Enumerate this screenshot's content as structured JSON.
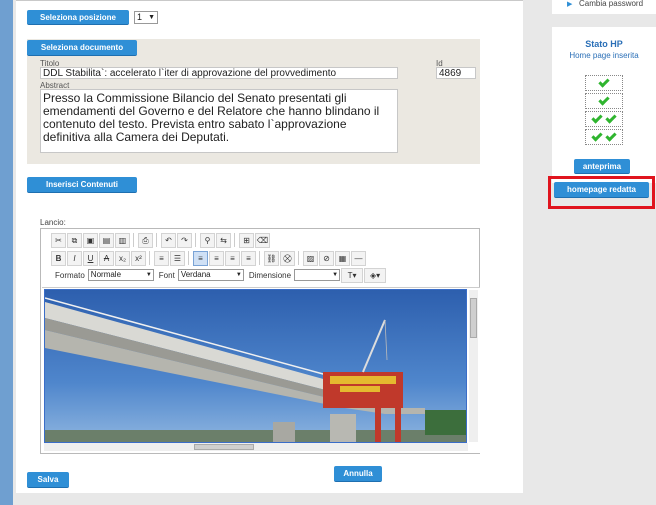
{
  "position": {
    "button_label": "Seleziona posizione",
    "select_value": "1"
  },
  "document": {
    "button_label": "Seleziona documento",
    "title_label": "Titolo",
    "title_value": "DDL Stabilita`: accelerato l`iter di approvazione del provvedimento",
    "id_label": "Id",
    "id_value": "4869",
    "abstract_label": "Abstract",
    "abstract_value": "Presso la Commissione Bilancio del Senato presentati gli emendamenti del Governo e del Relatore che hanno blindano il contenuto del testo. Prevista entro sabato l`approvazione definitiva alla Camera dei Deputati."
  },
  "insert_button_label": "Inserisci Contenuti",
  "editor": {
    "label": "Lancio:",
    "toolbar": {
      "format_label": "Formato",
      "format_value": "Normale",
      "font_label": "Font",
      "font_value": "Verdana",
      "size_label": "Dimensione",
      "size_value": ""
    }
  },
  "actions": {
    "save_label": "Salva",
    "cancel_label": "Annulla"
  },
  "sidebar": {
    "change_password_label": "Cambia password",
    "status_title": "Stato HP",
    "status_subtitle": "Home page inserita",
    "preview_label": "anteprima",
    "homepage_label": "homepage redatta"
  },
  "colors": {
    "button_blue": "#2f8fd6",
    "highlight_red": "#e0141e",
    "check_green": "#2fb52f"
  }
}
